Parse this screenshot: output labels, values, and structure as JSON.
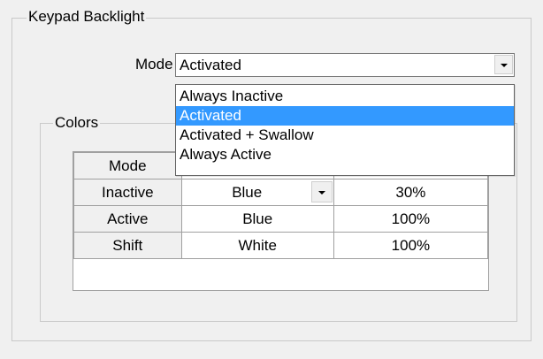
{
  "keypad_backlight": {
    "title": "Keypad Backlight",
    "mode_label": "Mode",
    "mode_value": "Activated",
    "mode_options": [
      "Always Inactive",
      "Activated",
      "Activated + Swallow",
      "Always Active"
    ],
    "selected_option_index": 1
  },
  "colors": {
    "title": "Colors",
    "header": {
      "label": "Mode",
      "col1": "",
      "col2": ""
    },
    "rows": [
      {
        "label": "Inactive",
        "color": "Blue",
        "percent": "30%"
      },
      {
        "label": "Active",
        "color": "Blue",
        "percent": "100%"
      },
      {
        "label": "Shift",
        "color": "White",
        "percent": "100%"
      }
    ]
  },
  "theme": {
    "selection": "#3399ff",
    "window_bg": "#f0f0f0",
    "group_border": "#c9c9c9"
  }
}
